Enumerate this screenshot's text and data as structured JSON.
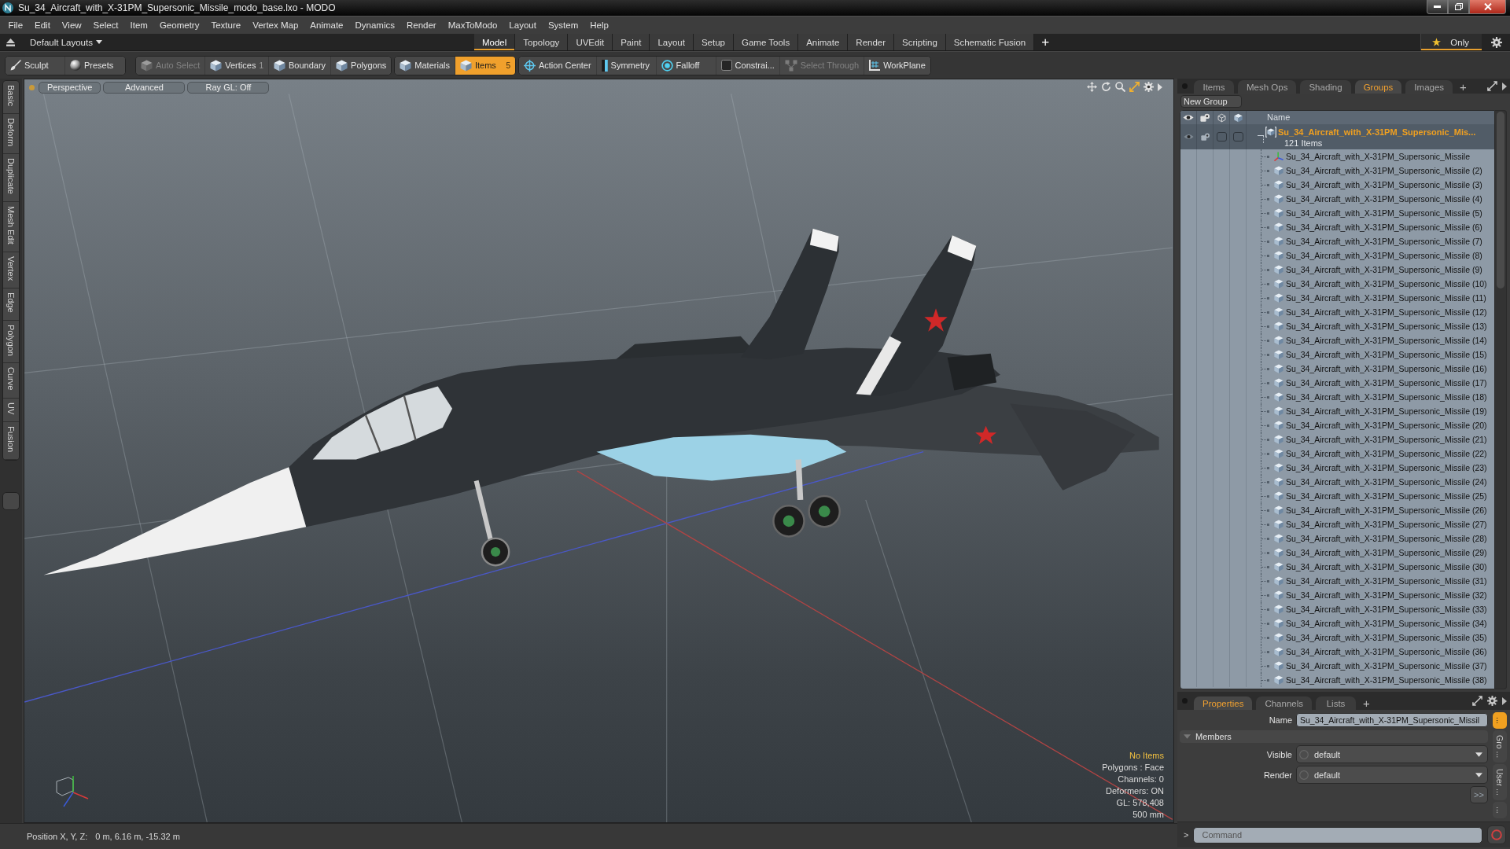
{
  "window": {
    "title": "Su_34_Aircraft_with_X-31PM_Supersonic_Missile_modo_base.lxo - MODO"
  },
  "menu_bar": [
    "File",
    "Edit",
    "View",
    "Select",
    "Item",
    "Geometry",
    "Texture",
    "Vertex Map",
    "Animate",
    "Dynamics",
    "Render",
    "MaxToModo",
    "Layout",
    "System",
    "Help"
  ],
  "layout_bar": {
    "layout_menu": "Default Layouts",
    "tabs": [
      {
        "label": "Model",
        "selected": true
      },
      {
        "label": "Topology",
        "selected": false
      },
      {
        "label": "UVEdit",
        "selected": false
      },
      {
        "label": "Paint",
        "selected": false
      },
      {
        "label": "Layout",
        "selected": false
      },
      {
        "label": "Setup",
        "selected": false
      },
      {
        "label": "Game Tools",
        "selected": false
      },
      {
        "label": "Animate",
        "selected": false
      },
      {
        "label": "Render",
        "selected": false
      },
      {
        "label": "Scripting",
        "selected": false
      },
      {
        "label": "Schematic Fusion",
        "selected": false
      }
    ],
    "add_tab": "+",
    "only_button": "Only"
  },
  "toolbar": {
    "groups": [
      {
        "items": [
          {
            "label": "Sculpt",
            "selected": false,
            "disabled": false
          },
          {
            "label": "Presets",
            "selected": false,
            "disabled": false
          }
        ]
      },
      {
        "items": [
          {
            "label": "Auto Select",
            "selected": false,
            "disabled": true
          },
          {
            "label": "Vertices",
            "count": "1",
            "selected": false,
            "disabled": false
          },
          {
            "label": "Boundary",
            "selected": false,
            "disabled": false
          },
          {
            "label": "Polygons",
            "selected": false,
            "disabled": false
          }
        ]
      },
      {
        "items": [
          {
            "label": "Materials",
            "selected": false,
            "disabled": false
          },
          {
            "label": "Items",
            "count": "5",
            "selected": true,
            "disabled": false
          }
        ]
      },
      {
        "items": [
          {
            "label": "Action Center",
            "selected": false,
            "disabled": false
          },
          {
            "label": "Symmetry",
            "selected": false,
            "disabled": false
          },
          {
            "label": "Falloff",
            "selected": false,
            "disabled": false
          },
          {
            "label": "Constrai...",
            "selected": false,
            "disabled": false
          },
          {
            "label": "Select Through",
            "selected": false,
            "disabled": true
          },
          {
            "label": "WorkPlane",
            "selected": false,
            "disabled": false
          }
        ]
      }
    ]
  },
  "tool_tabs": [
    {
      "label": "Basic",
      "selected": false
    },
    {
      "label": "Deform",
      "selected": false
    },
    {
      "label": "Duplicate",
      "selected": false
    },
    {
      "label": "Mesh Edit",
      "selected": false
    },
    {
      "label": "Vertex",
      "selected": false
    },
    {
      "label": "Edge",
      "selected": false
    },
    {
      "label": "Polygon",
      "selected": false
    },
    {
      "label": "Curve",
      "selected": false
    },
    {
      "label": "UV",
      "selected": false
    },
    {
      "label": "Fusion",
      "selected": false
    }
  ],
  "viewport": {
    "buttons": [
      "Perspective",
      "Advanced",
      "Ray GL: Off"
    ],
    "info": [
      {
        "text": "No Items",
        "highlight": true
      },
      {
        "text": "Polygons : Face",
        "highlight": false
      },
      {
        "text": "Channels: 0",
        "highlight": false
      },
      {
        "text": "Deformers: ON",
        "highlight": false
      },
      {
        "text": "GL: 578,408",
        "highlight": false
      },
      {
        "text": "500 mm",
        "highlight": false
      }
    ]
  },
  "status_bar": {
    "label": "Position X, Y, Z:",
    "value": "0 m, 6.16 m, -15.32 m"
  },
  "item_panel": {
    "tabs": [
      {
        "label": "Items",
        "selected": false
      },
      {
        "label": "Mesh Ops",
        "selected": false
      },
      {
        "label": "Shading",
        "selected": false
      },
      {
        "label": "Groups",
        "selected": true
      },
      {
        "label": "Images",
        "selected": false
      }
    ],
    "add_tab": "+",
    "new_group_button": "New Group",
    "name_column": "Name",
    "group": {
      "name": "Su_34_Aircraft_with_X-31PM_Supersonic_Mis...",
      "count": "121 Items",
      "selected": true,
      "expanded": true
    },
    "items": [
      {
        "name": "Su_34_Aircraft_with_X-31PM_Supersonic_Missile",
        "kind": "locator"
      },
      {
        "name": "Su_34_Aircraft_with_X-31PM_Supersonic_Missile (2)",
        "kind": "mesh"
      },
      {
        "name": "Su_34_Aircraft_with_X-31PM_Supersonic_Missile (3)",
        "kind": "mesh"
      },
      {
        "name": "Su_34_Aircraft_with_X-31PM_Supersonic_Missile (4)",
        "kind": "mesh"
      },
      {
        "name": "Su_34_Aircraft_with_X-31PM_Supersonic_Missile (5)",
        "kind": "mesh"
      },
      {
        "name": "Su_34_Aircraft_with_X-31PM_Supersonic_Missile (6)",
        "kind": "mesh"
      },
      {
        "name": "Su_34_Aircraft_with_X-31PM_Supersonic_Missile (7)",
        "kind": "mesh"
      },
      {
        "name": "Su_34_Aircraft_with_X-31PM_Supersonic_Missile (8)",
        "kind": "mesh"
      },
      {
        "name": "Su_34_Aircraft_with_X-31PM_Supersonic_Missile (9)",
        "kind": "mesh"
      },
      {
        "name": "Su_34_Aircraft_with_X-31PM_Supersonic_Missile (10)",
        "kind": "mesh"
      },
      {
        "name": "Su_34_Aircraft_with_X-31PM_Supersonic_Missile (11)",
        "kind": "mesh"
      },
      {
        "name": "Su_34_Aircraft_with_X-31PM_Supersonic_Missile (12)",
        "kind": "mesh"
      },
      {
        "name": "Su_34_Aircraft_with_X-31PM_Supersonic_Missile (13)",
        "kind": "mesh"
      },
      {
        "name": "Su_34_Aircraft_with_X-31PM_Supersonic_Missile (14)",
        "kind": "mesh"
      },
      {
        "name": "Su_34_Aircraft_with_X-31PM_Supersonic_Missile (15)",
        "kind": "mesh"
      },
      {
        "name": "Su_34_Aircraft_with_X-31PM_Supersonic_Missile (16)",
        "kind": "mesh"
      },
      {
        "name": "Su_34_Aircraft_with_X-31PM_Supersonic_Missile (17)",
        "kind": "mesh"
      },
      {
        "name": "Su_34_Aircraft_with_X-31PM_Supersonic_Missile (18)",
        "kind": "mesh"
      },
      {
        "name": "Su_34_Aircraft_with_X-31PM_Supersonic_Missile (19)",
        "kind": "mesh"
      },
      {
        "name": "Su_34_Aircraft_with_X-31PM_Supersonic_Missile (20)",
        "kind": "mesh"
      },
      {
        "name": "Su_34_Aircraft_with_X-31PM_Supersonic_Missile (21)",
        "kind": "mesh"
      },
      {
        "name": "Su_34_Aircraft_with_X-31PM_Supersonic_Missile (22)",
        "kind": "mesh"
      },
      {
        "name": "Su_34_Aircraft_with_X-31PM_Supersonic_Missile (23)",
        "kind": "mesh"
      },
      {
        "name": "Su_34_Aircraft_with_X-31PM_Supersonic_Missile (24)",
        "kind": "mesh"
      },
      {
        "name": "Su_34_Aircraft_with_X-31PM_Supersonic_Missile (25)",
        "kind": "mesh"
      },
      {
        "name": "Su_34_Aircraft_with_X-31PM_Supersonic_Missile (26)",
        "kind": "mesh"
      },
      {
        "name": "Su_34_Aircraft_with_X-31PM_Supersonic_Missile (27)",
        "kind": "mesh"
      },
      {
        "name": "Su_34_Aircraft_with_X-31PM_Supersonic_Missile (28)",
        "kind": "mesh"
      },
      {
        "name": "Su_34_Aircraft_with_X-31PM_Supersonic_Missile (29)",
        "kind": "mesh"
      },
      {
        "name": "Su_34_Aircraft_with_X-31PM_Supersonic_Missile (30)",
        "kind": "mesh"
      },
      {
        "name": "Su_34_Aircraft_with_X-31PM_Supersonic_Missile (31)",
        "kind": "mesh"
      },
      {
        "name": "Su_34_Aircraft_with_X-31PM_Supersonic_Missile (32)",
        "kind": "mesh"
      },
      {
        "name": "Su_34_Aircraft_with_X-31PM_Supersonic_Missile (33)",
        "kind": "mesh"
      },
      {
        "name": "Su_34_Aircraft_with_X-31PM_Supersonic_Missile (34)",
        "kind": "mesh"
      },
      {
        "name": "Su_34_Aircraft_with_X-31PM_Supersonic_Missile (35)",
        "kind": "mesh"
      },
      {
        "name": "Su_34_Aircraft_with_X-31PM_Supersonic_Missile (36)",
        "kind": "mesh"
      },
      {
        "name": "Su_34_Aircraft_with_X-31PM_Supersonic_Missile (37)",
        "kind": "mesh"
      },
      {
        "name": "Su_34_Aircraft_with_X-31PM_Supersonic_Missile (38)",
        "kind": "mesh"
      }
    ]
  },
  "properties": {
    "tabs": [
      {
        "label": "Properties",
        "selected": true
      },
      {
        "label": "Channels",
        "selected": false
      },
      {
        "label": "Lists",
        "selected": false
      }
    ],
    "add_tab": "+",
    "name_label": "Name",
    "name_value": "Su_34_Aircraft_with_X-31PM_Supersonic_Missil",
    "section": {
      "title": "Members",
      "expanded": true
    },
    "dropdowns": [
      {
        "label": "Visible",
        "value": "default"
      },
      {
        "label": "Render",
        "value": "default"
      }
    ],
    "more_button": ">>",
    "side_tabs": [
      {
        "label": "...",
        "selected": true
      },
      {
        "label": "Gro ...",
        "selected": false
      },
      {
        "label": "User ...",
        "selected": false
      },
      {
        "label": "...",
        "selected": false
      }
    ]
  },
  "command_bar": {
    "prompt": ">",
    "placeholder": "Command"
  }
}
